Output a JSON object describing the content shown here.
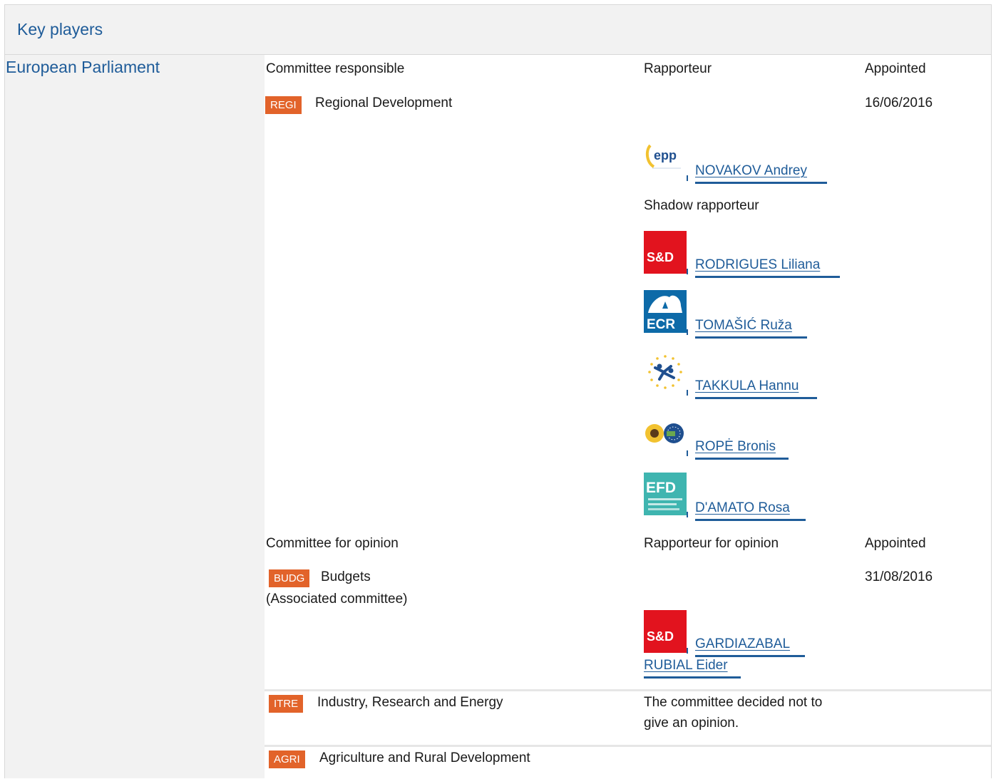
{
  "header": {
    "title": "Key players"
  },
  "institution": {
    "name": "European Parliament"
  },
  "responsible": {
    "col_committee": "Committee responsible",
    "col_rapporteur": "Rapporteur",
    "col_appointed": "Appointed",
    "committee": {
      "code": "REGI",
      "name": "Regional Development",
      "appointed": "16/06/2016"
    },
    "rapporteur": {
      "group_logo": "epp-logo",
      "name": "NOVAKOV Andrey"
    },
    "shadow_label": "Shadow rapporteur",
    "shadows": [
      {
        "group_logo": "sd-logo",
        "name": "RODRIGUES Liliana"
      },
      {
        "group_logo": "ecr-logo",
        "name": "TOMAŠIĆ Ruža"
      },
      {
        "group_logo": "alde-logo",
        "name": "TAKKULA Hannu"
      },
      {
        "group_logo": "greens-efa-logo",
        "name": "ROPĖ Bronis"
      },
      {
        "group_logo": "efd-logo",
        "name": "D'AMATO Rosa"
      }
    ]
  },
  "opinion": {
    "col_committee": "Committee for opinion",
    "col_rapporteur": "Rapporteur for opinion",
    "col_appointed": "Appointed",
    "entries": [
      {
        "code": "BUDG",
        "name": "Budgets",
        "note": "(Associated committee)",
        "appointed": "31/08/2016",
        "rapporteur": {
          "group_logo": "sd-logo",
          "name_line1": "GARDIAZABAL",
          "name_line2": "RUBIAL Eider"
        }
      },
      {
        "code": "ITRE",
        "name": "Industry, Research and Energy",
        "status_line1": "The committee decided not to",
        "status_line2": "give an opinion."
      },
      {
        "code": "AGRI",
        "name": "Agriculture and Rural Development"
      }
    ]
  },
  "colors": {
    "link": "#1f5c99",
    "badge": "#e2632a",
    "frame_bg": "#f2f2f2",
    "separator": "#e6e6e6"
  }
}
